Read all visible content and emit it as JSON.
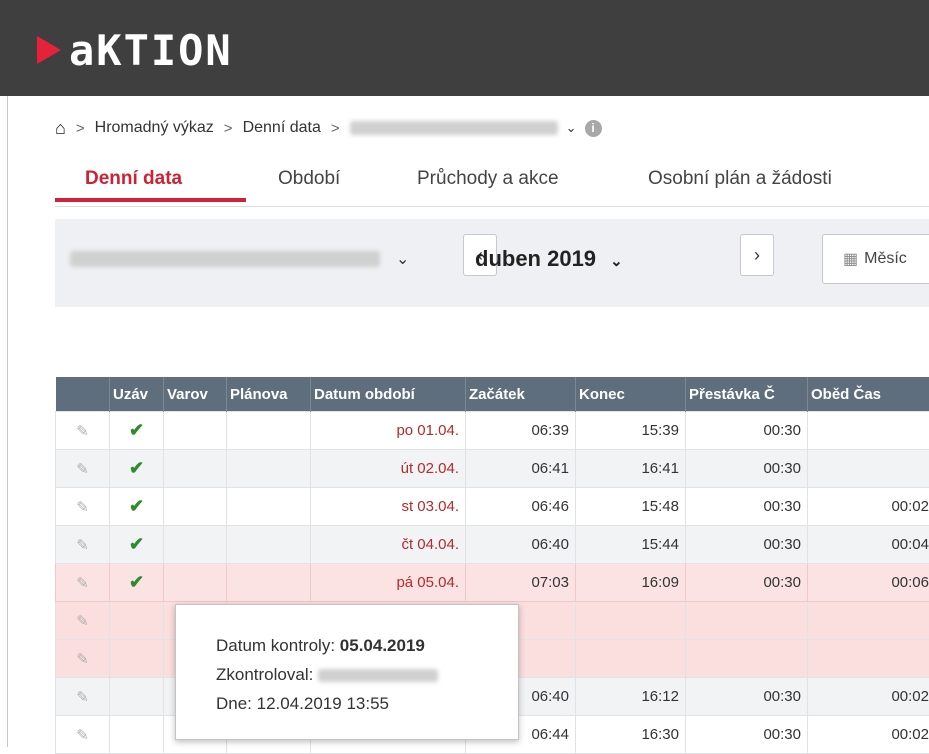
{
  "brand": {
    "name": "aKTION",
    "accent": "#e6223a"
  },
  "breadcrumb": {
    "home_icon": "home-icon",
    "items": [
      "Hromadný výkaz",
      "Denní data"
    ],
    "info_icon": "info-icon"
  },
  "tabs": [
    "Denní data",
    "Období",
    "Průchody a akce",
    "Osobní plán a žádosti"
  ],
  "toolbar": {
    "period": "duben 2019",
    "prev": "‹",
    "next": "›",
    "month_btn": "Měsíc",
    "calendar_icon": "calendar-icon"
  },
  "table": {
    "headers": [
      "",
      "Uzáv",
      "Varov",
      "Plánova",
      "Datum období",
      "Začátek",
      "Konec",
      "Přestávka Č",
      "Oběd Čas"
    ],
    "rows": [
      {
        "check": "✔",
        "date": "po 01.04.",
        "start": "06:39",
        "end": "15:39",
        "break": "00:30",
        "lunch": ""
      },
      {
        "check": "✔",
        "date": "út 02.04.",
        "start": "06:41",
        "end": "16:41",
        "break": "00:30",
        "lunch": ""
      },
      {
        "check": "✔",
        "date": "st 03.04.",
        "start": "06:46",
        "end": "15:48",
        "break": "00:30",
        "lunch": "00:02"
      },
      {
        "check": "✔",
        "date": "čt 04.04.",
        "start": "06:40",
        "end": "15:44",
        "break": "00:30",
        "lunch": "00:04"
      },
      {
        "check": "✔",
        "date": "pá 05.04.",
        "start": "07:03",
        "end": "16:09",
        "break": "00:30",
        "lunch": "00:06"
      },
      {
        "check": "",
        "date": "",
        "start": "",
        "end": "",
        "break": "",
        "lunch": ""
      },
      {
        "check": "",
        "date": "",
        "start": "",
        "end": "",
        "break": "",
        "lunch": ""
      },
      {
        "check": "",
        "date": "",
        "start": "06:40",
        "end": "16:12",
        "break": "00:30",
        "lunch": "00:02"
      },
      {
        "check": "",
        "date": "",
        "start": "06:44",
        "end": "16:30",
        "break": "00:30",
        "lunch": "00:02"
      }
    ]
  },
  "tooltip": {
    "line1_label": "Datum kontroly:",
    "line1_value": "05.04.2019",
    "line2_label": "Zkontroloval:",
    "line3": "Dne: 12.04.2019 13:55"
  }
}
